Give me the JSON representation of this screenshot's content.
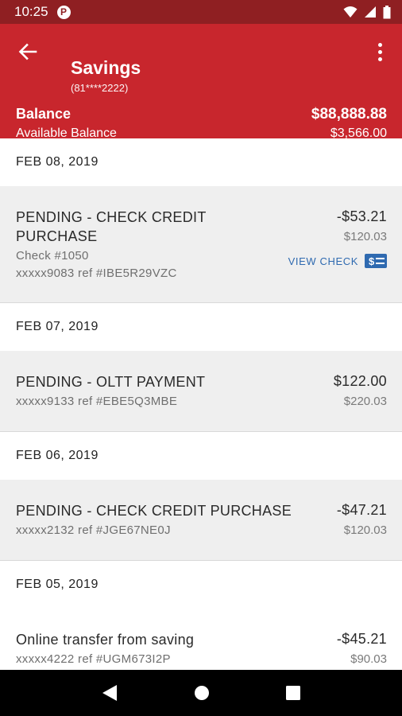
{
  "status_bar": {
    "time": "10:25",
    "badge": "P"
  },
  "header": {
    "title": "Savings",
    "account_number": "(81****2222)",
    "balance_label": "Balance",
    "balance_value": "$88,888.88",
    "available_label": "Available Balance",
    "available_value": "$3,566.00"
  },
  "groups": [
    {
      "date": "FEB 08, 2019",
      "transactions": [
        {
          "desc_line1": "PENDING - CHECK CREDIT",
          "desc_line2": "PURCHASE",
          "check_no": "Check #1050",
          "ref": "xxxxx9083 ref #IBE5R29VZC",
          "amount": "-$53.21",
          "balance": "$120.03",
          "view_check": "VIEW CHECK"
        }
      ]
    },
    {
      "date": "FEB 07, 2019",
      "transactions": [
        {
          "desc": "PENDING - OLTT PAYMENT",
          "ref": "xxxxx9133 ref #EBE5Q3MBE",
          "amount": "$122.00",
          "balance": "$220.03"
        }
      ]
    },
    {
      "date": "FEB 06, 2019",
      "transactions": [
        {
          "desc": "PENDING - CHECK CREDIT PURCHASE",
          "ref": "xxxxx2132 ref #JGE67NE0J",
          "amount": "-$47.21",
          "balance": "$120.03"
        }
      ]
    },
    {
      "date": "FEB 05, 2019",
      "transactions": [
        {
          "desc": "Online transfer from saving",
          "ref": "xxxxx4222 ref #UGM673I2P",
          "amount": "-$45.21",
          "balance": "$90.03"
        }
      ]
    }
  ],
  "icons": {
    "back": "arrow-left-icon",
    "menu": "more-vert-icon",
    "check": "check-dollar-icon",
    "wifi": "wifi-icon",
    "signal": "signal-icon",
    "battery": "battery-icon"
  },
  "colors": {
    "header": "#c8262d",
    "status_bar": "#8f1f22",
    "link": "#2f6ab0"
  }
}
